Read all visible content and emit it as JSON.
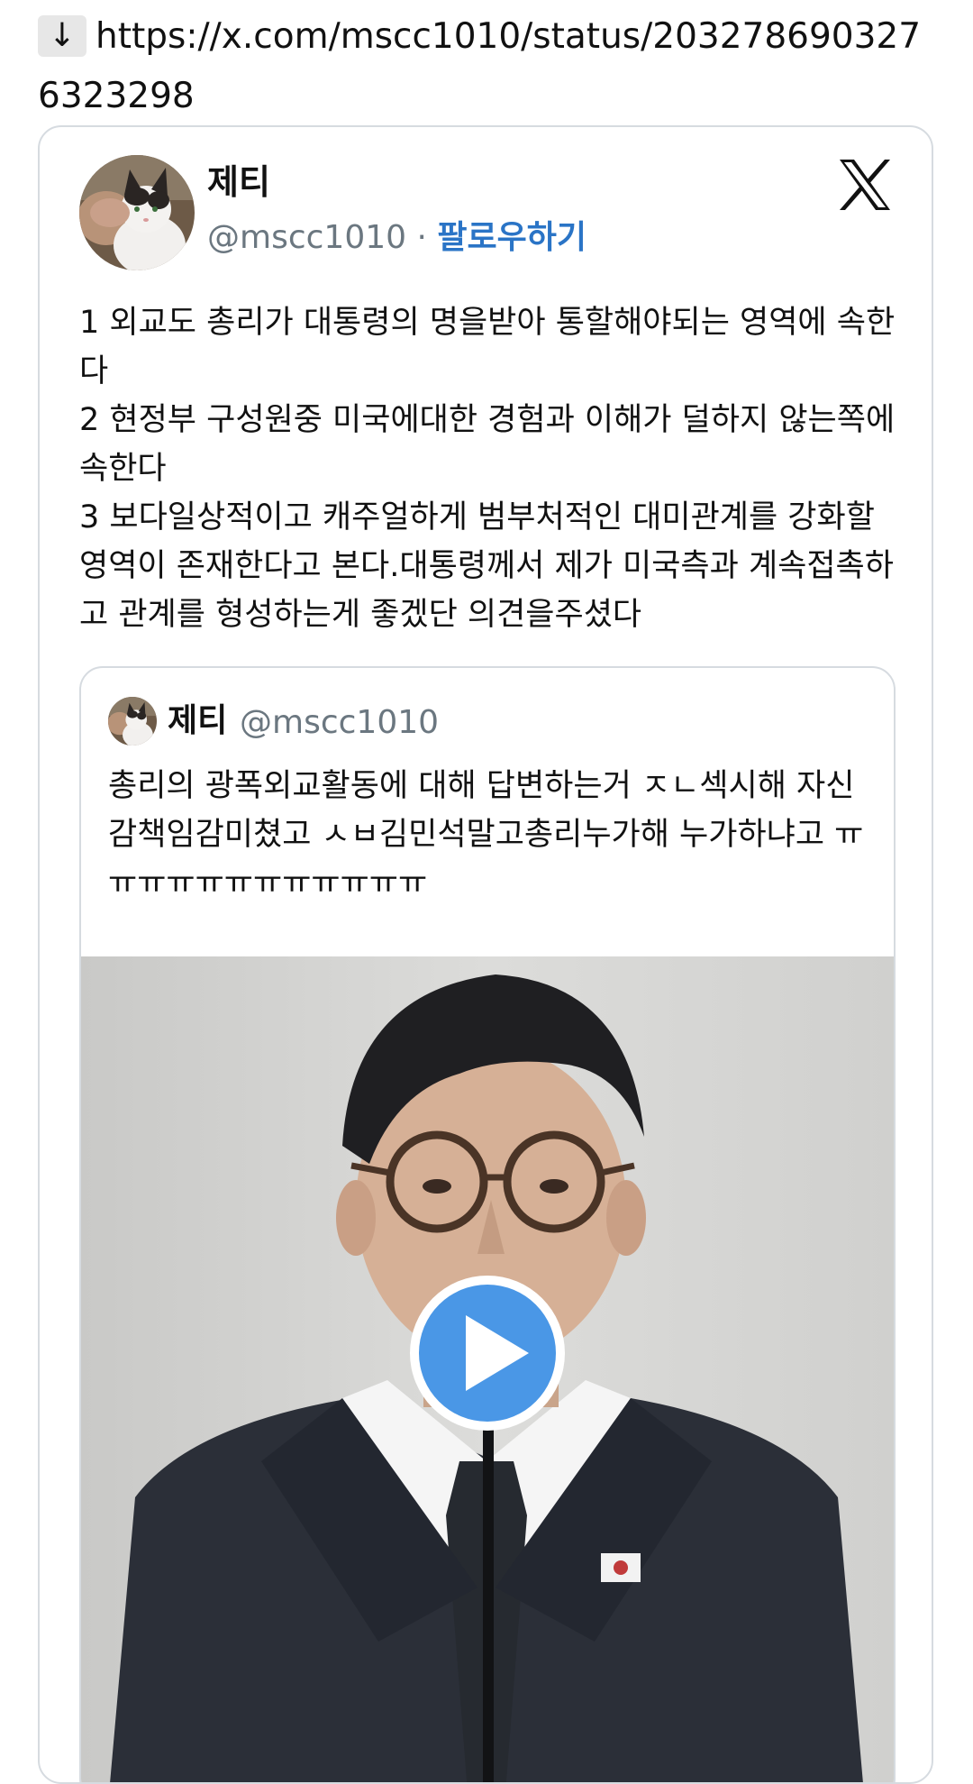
{
  "link": {
    "arrow": "↓",
    "url": "https://x.com/mscc1010/status/2032786903276323298"
  },
  "tweet": {
    "author_name": "제티",
    "handle": "@mscc1010",
    "separator": "·",
    "follow_label": "팔로우하기",
    "lines": [
      "1 외교도 총리가 대통령의 명을받아 통할해야되는 영역에 속한다",
      "2 현정부 구성원중 미국에대한 경험과 이해가 덜하지 않는쪽에속한다",
      "3 보다일상적이고 캐주얼하게 범부처적인 대미관계를 강화할영역이 존재한다고 본다.대통령께서 제가 미국측과 계속접촉하고 관계를 형성하는게 좋겠단 의견을주셨다"
    ]
  },
  "quote": {
    "author_name": "제티",
    "handle": "@mscc1010",
    "text": "총리의 광폭외교활동에 대해 답변하는거 ㅈㄴ섹시해 자신감책임감미쳤고 ㅅㅂ김민석말고총리누가해 누가하냐고 ㅠㅠㅠㅠㅠㅠㅠㅠㅠㅠㅠㅠ"
  },
  "icons": {
    "link_arrow": "down-arrow-icon",
    "brand": "x-logo-icon",
    "video": "play-icon"
  },
  "colors": {
    "follow_link": "#2a74c6",
    "handle": "#6b7780",
    "play_button": "#4a97e6",
    "border": "#d6dbe0"
  }
}
